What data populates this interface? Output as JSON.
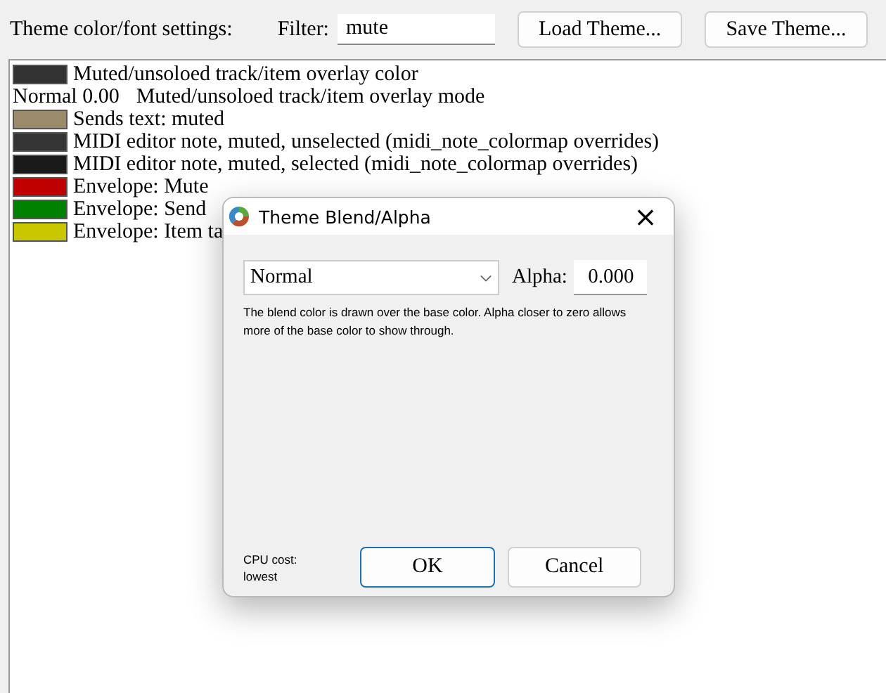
{
  "toolbar": {
    "label": "Theme color/font settings:",
    "filter_label": "Filter:",
    "filter_value": "mute",
    "buttons": [
      "Load Theme...",
      "Save Theme..."
    ]
  },
  "items": [
    {
      "kind": "swatch",
      "color": "#333333",
      "label": "Muted/unsoloed track/item overlay color"
    },
    {
      "kind": "mode",
      "mode": "Normal 0.00",
      "label": "Muted/unsoloed track/item overlay mode"
    },
    {
      "kind": "swatch",
      "color": "#9b8a6c",
      "label": "Sends text: muted"
    },
    {
      "kind": "swatch",
      "color": "#353535",
      "label": "MIDI editor note, muted, unselected (midi_note_colormap overrides)"
    },
    {
      "kind": "swatch",
      "color": "#1a1a1a",
      "label": "MIDI editor note, muted, selected (midi_note_colormap overrides)"
    },
    {
      "kind": "swatch",
      "color": "#c00000",
      "label": "Envelope: Mute"
    },
    {
      "kind": "swatch",
      "color": "#008000",
      "label": "Envelope: Send"
    },
    {
      "kind": "swatch",
      "color": "#c8c800",
      "label": "Envelope: Item ta"
    }
  ],
  "dialog": {
    "title": "Theme Blend/Alpha",
    "close": "×",
    "mode": "Normal",
    "alpha_label": "Alpha:",
    "alpha_value": "0.000",
    "description": "The blend color is drawn over the base color. Alpha closer to zero allows more of the base color to show through.",
    "cpu_cost": "CPU cost:",
    "cpu_value": "lowest",
    "buttons": [
      "OK",
      "Cancel"
    ]
  }
}
